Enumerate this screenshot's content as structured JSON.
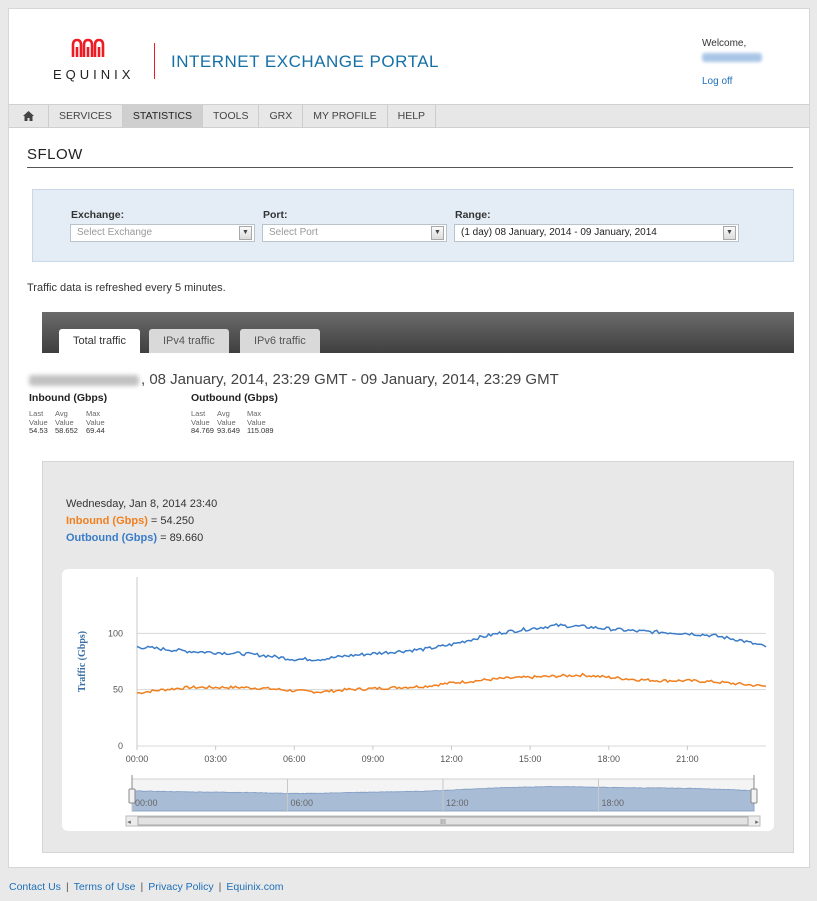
{
  "header": {
    "logo_text": "EQUINIX",
    "portal_title": "INTERNET EXCHANGE PORTAL",
    "welcome": "Welcome,",
    "logoff": "Log off"
  },
  "nav": {
    "items": [
      {
        "label": "SERVICES",
        "active": false
      },
      {
        "label": "STATISTICS",
        "active": true
      },
      {
        "label": "TOOLS",
        "active": false
      },
      {
        "label": "GRX",
        "active": false
      },
      {
        "label": "MY PROFILE",
        "active": false
      },
      {
        "label": "HELP",
        "active": false
      }
    ]
  },
  "page_title": "SFLOW",
  "filters": {
    "exchange": {
      "label": "Exchange:",
      "placeholder": "Select Exchange"
    },
    "port": {
      "label": "Port:",
      "placeholder": "Select Port"
    },
    "range": {
      "label": "Range:",
      "value": "(1 day) 08 January, 2014 - 09 January, 2014"
    }
  },
  "refresh_note": "Traffic data is refreshed every 5 minutes.",
  "tabs": [
    {
      "label": "Total traffic",
      "active": true
    },
    {
      "label": "IPv4 traffic",
      "active": false
    },
    {
      "label": "IPv6 traffic",
      "active": false
    }
  ],
  "period_text": ", 08 January, 2014, 23:29 GMT - 09 January, 2014, 23:29 GMT",
  "stats": {
    "inbound": {
      "title": "Inbound (Gbps)",
      "cols": [
        {
          "l1": "Last",
          "l2": "Value",
          "v": "54.53"
        },
        {
          "l1": "Avg",
          "l2": "Value",
          "v": "58.652"
        },
        {
          "l1": "Max",
          "l2": "Value",
          "v": "69.44"
        }
      ]
    },
    "outbound": {
      "title": "Outbound (Gbps)",
      "cols": [
        {
          "l1": "Last",
          "l2": "Value",
          "v": "84.769"
        },
        {
          "l1": "Avg",
          "l2": "Value",
          "v": "93.649"
        },
        {
          "l1": "Max",
          "l2": "Value",
          "v": "115.089"
        }
      ]
    }
  },
  "tooltip": {
    "date": "Wednesday, Jan 8, 2014 23:40",
    "inbound_label": "Inbound (Gbps)",
    "inbound_value": " = 54.250",
    "outbound_label": "Outbound (Gbps)",
    "outbound_value": " = 89.660"
  },
  "footer": {
    "links": [
      "Contact Us",
      "Terms of Use",
      "Privacy Policy",
      "Equinix.com"
    ],
    "separator": "|"
  },
  "colors": {
    "inbound": "#f07f1e",
    "outbound": "#3a7cc8",
    "navigator_fill": "#a9bcd6",
    "accent": "#ed1c24",
    "link": "#1e6fb8"
  },
  "chart_data": {
    "type": "line",
    "ylabel": "Traffic (Gbps)",
    "ylim": [
      0,
      150
    ],
    "yticks": [
      0,
      50,
      100
    ],
    "xlim": [
      0,
      24
    ],
    "xtick_labels": [
      "00:00",
      "03:00",
      "06:00",
      "09:00",
      "12:00",
      "15:00",
      "18:00",
      "21:00"
    ],
    "navigator_labels": [
      "00:00",
      "06:00",
      "12:00",
      "18:00"
    ],
    "navigator_scroll_label": "III",
    "x": [
      0,
      1,
      2,
      3,
      4,
      5,
      6,
      7,
      8,
      9,
      10,
      11,
      12,
      13,
      14,
      15,
      16,
      17,
      18,
      19,
      20,
      21,
      22,
      23,
      24
    ],
    "series": [
      {
        "name": "Inbound (Gbps)",
        "values": [
          47,
          50,
          52,
          52,
          52,
          51,
          49,
          48,
          50,
          51,
          52,
          53,
          56,
          58,
          60,
          61,
          62,
          63,
          61,
          59,
          58,
          58,
          57,
          55,
          53
        ]
      },
      {
        "name": "Outbound (Gbps)",
        "values": [
          88,
          86,
          84,
          83,
          82,
          80,
          77,
          77,
          80,
          82,
          84,
          86,
          90,
          96,
          101,
          104,
          107,
          106,
          104,
          102,
          101,
          100,
          98,
          94,
          88
        ]
      }
    ]
  }
}
